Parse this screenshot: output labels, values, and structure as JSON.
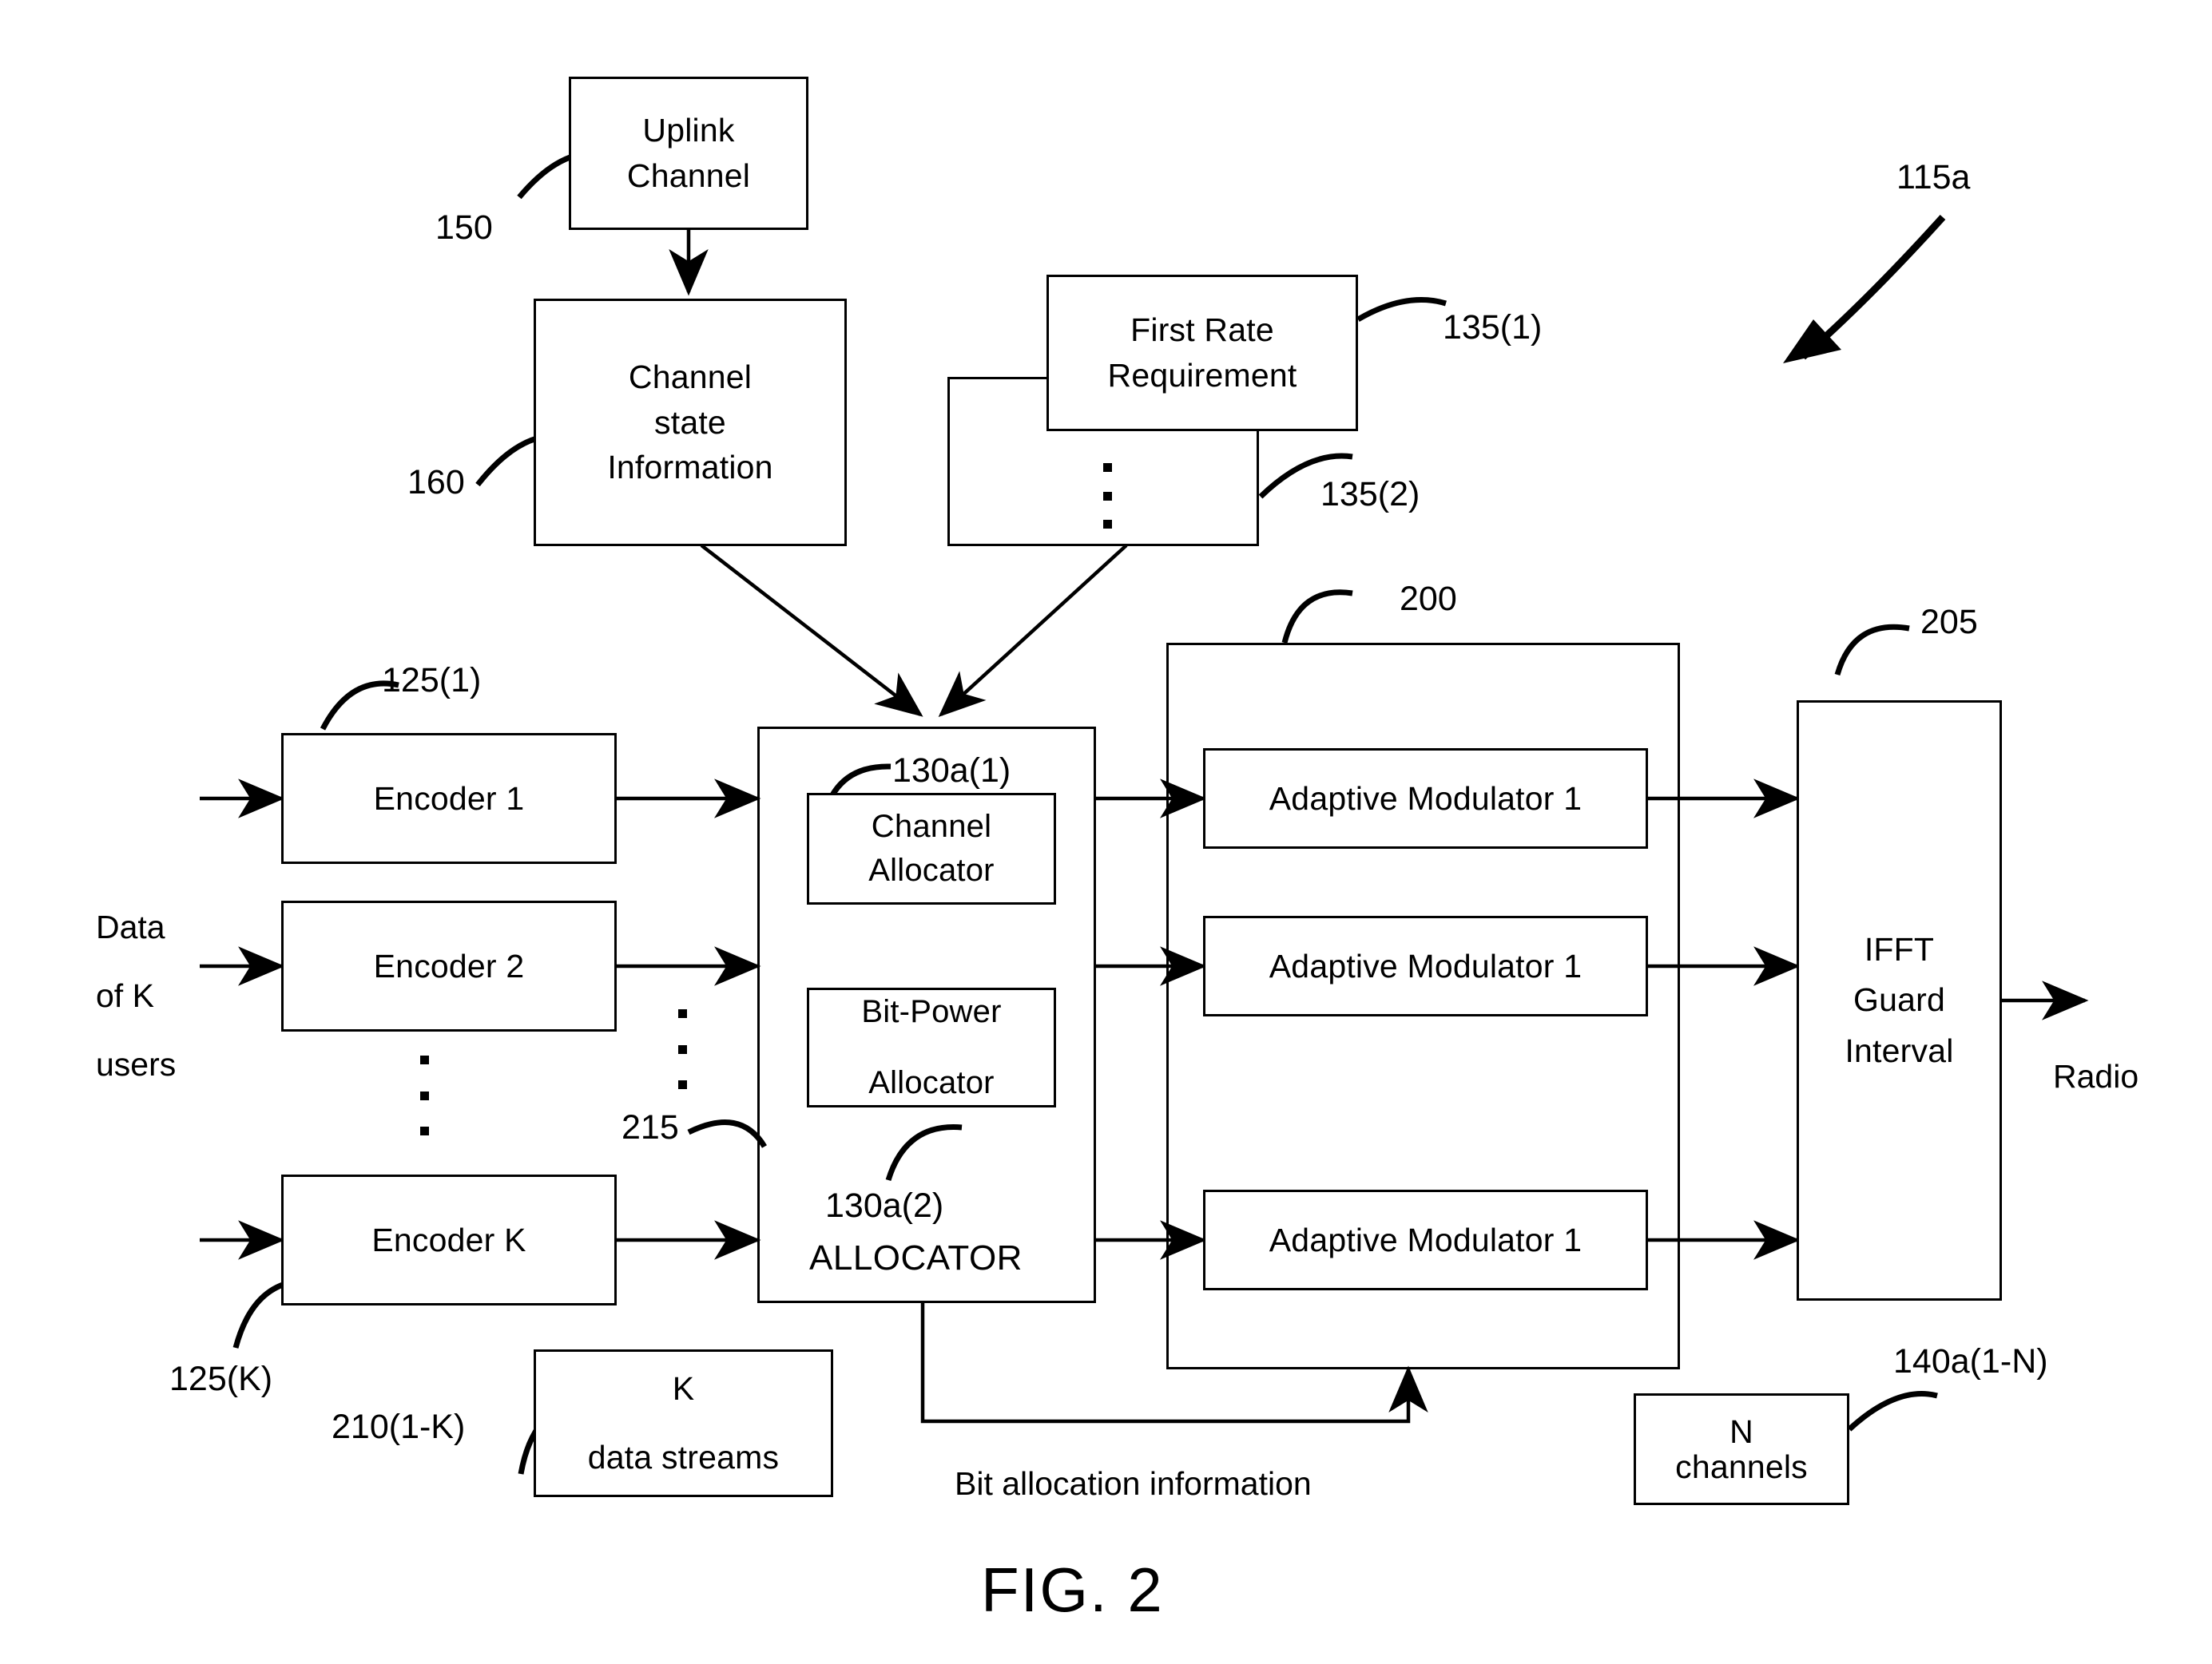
{
  "figure": {
    "caption": "FIG. 2",
    "system_ref": "115a"
  },
  "blocks": {
    "uplink_channel": {
      "label": "Uplink\nChannel",
      "ref": "150"
    },
    "channel_state_information": {
      "label": "Channel\nstate\nInformation",
      "ref": "160"
    },
    "first_rate_requirement": {
      "label": "First Rate\nRequirement",
      "ref": "135(1)"
    },
    "second_rate_requirement": {
      "label": "",
      "ref": "135(2)"
    },
    "encoders": [
      {
        "label": "Encoder 1",
        "ref": "125(1)"
      },
      {
        "label": "Encoder 2",
        "ref": ""
      },
      {
        "label": "Encoder K",
        "ref": "125(K)"
      }
    ],
    "allocator": {
      "title": "ALLOCATOR",
      "channel_allocator": {
        "label": "Channel\nAllocator",
        "ref": "130a(1)"
      },
      "bit_power_allocator": {
        "label": "Bit-Power\n\nAllocator",
        "ref": "130a(2)"
      }
    },
    "modulators": {
      "container_ref": "200",
      "items": [
        {
          "label": "Adaptive Modulator 1"
        },
        {
          "label": "Adaptive Modulator 1"
        },
        {
          "label": "Adaptive Modulator 1"
        }
      ]
    },
    "ifft": {
      "label": "IFFT\nGuard\nInterval",
      "ref": "205"
    },
    "k_data_streams": {
      "label": "K\n\ndata streams",
      "ref": "210(1-K)"
    },
    "n_channels": {
      "label": "N\nchannels",
      "ref": "140a(1-N)"
    }
  },
  "labels": {
    "data_of_k_users": "Data\n\nof K\n\nusers",
    "radio": "Radio",
    "bit_allocation_information": "Bit allocation information",
    "streams_ref": "215"
  },
  "colors": {
    "ink": "#000000",
    "paper": "#ffffff"
  }
}
